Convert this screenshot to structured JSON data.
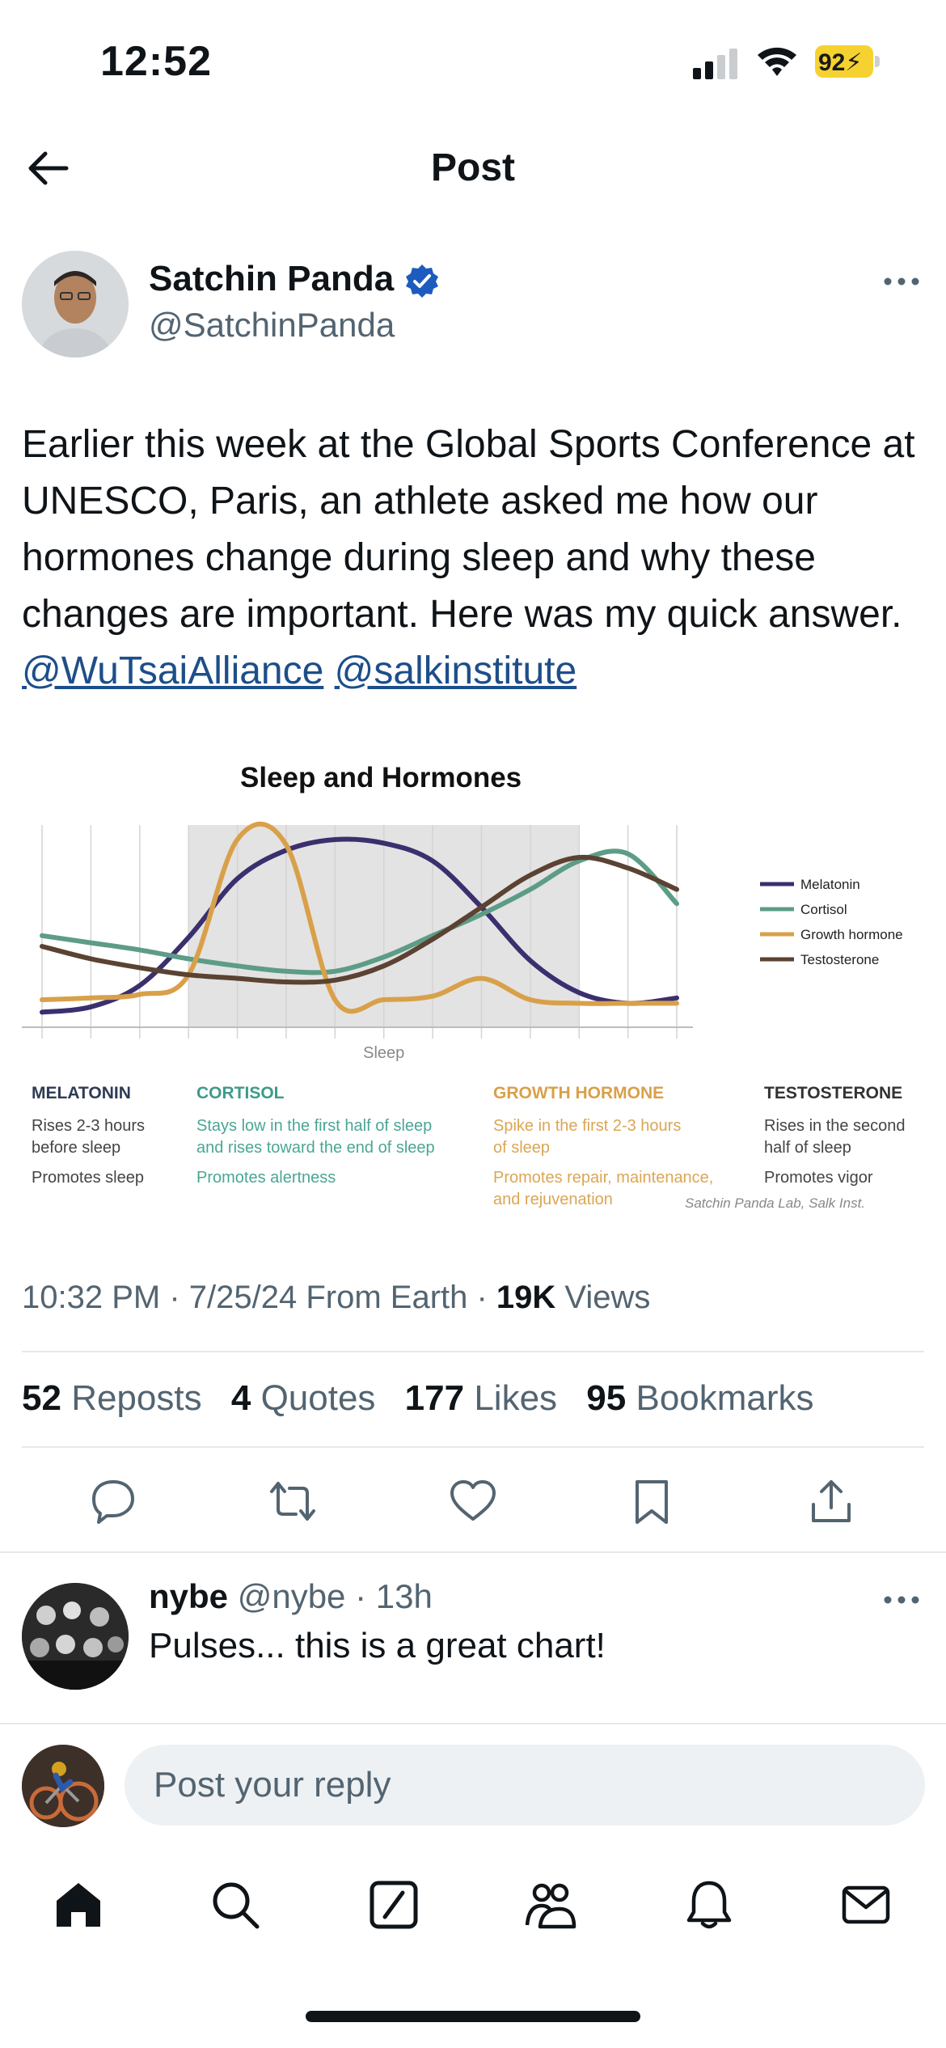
{
  "status_bar": {
    "time": "12:52",
    "battery": "92"
  },
  "header": {
    "title": "Post",
    "back_icon": "arrow-left-icon"
  },
  "post": {
    "author_name": "Satchin Panda",
    "author_handle": "@SatchinPanda",
    "text_plain": "Earlier this week at the Global Sports Conference at UNESCO, Paris, an athlete asked me how our hormones change during sleep and why these changes are important. Here was my quick answer. ",
    "mention_1": "@WuTsaiAlliance",
    "mention_2": "@salkinstitute",
    "timestamp": "10:32 PM · 7/25/24 From Earth · ",
    "views_count": "19K",
    "views_label": " Views",
    "stats": [
      {
        "count": "52",
        "label": "Reposts"
      },
      {
        "count": "4",
        "label": "Quotes"
      },
      {
        "count": "177",
        "label": "Likes"
      },
      {
        "count": "95",
        "label": "Bookmarks"
      }
    ]
  },
  "chart_data": {
    "type": "line",
    "title": "Sleep and Hormones",
    "xlabel": "Sleep",
    "x": [
      0,
      1,
      2,
      3,
      4,
      5,
      6,
      7,
      8,
      9,
      10,
      11,
      12,
      13
    ],
    "ylim": [
      0,
      1
    ],
    "sleep_period": [
      3,
      11
    ],
    "legend_position": "right",
    "series": [
      {
        "name": "Melatonin",
        "color": "#3b2f6e",
        "values": [
          0.03,
          0.06,
          0.18,
          0.45,
          0.78,
          0.94,
          1.0,
          0.98,
          0.88,
          0.62,
          0.32,
          0.14,
          0.08,
          0.11
        ]
      },
      {
        "name": "Cortisol",
        "color": "#5d9c86",
        "values": [
          0.46,
          0.42,
          0.38,
          0.33,
          0.29,
          0.26,
          0.26,
          0.34,
          0.46,
          0.58,
          0.72,
          0.88,
          0.92,
          0.64
        ]
      },
      {
        "name": "Growth hormone",
        "color": "#d9a04a",
        "values": [
          0.1,
          0.11,
          0.13,
          0.24,
          1.0,
          0.97,
          0.1,
          0.1,
          0.12,
          0.22,
          0.1,
          0.08,
          0.08,
          0.08
        ]
      },
      {
        "name": "Testosterone",
        "color": "#5b4232",
        "values": [
          0.4,
          0.33,
          0.28,
          0.24,
          0.22,
          0.2,
          0.21,
          0.29,
          0.44,
          0.62,
          0.8,
          0.9,
          0.84,
          0.72
        ]
      }
    ],
    "descriptions": [
      {
        "title": "MELATONIN",
        "color": "#2f3a55",
        "line1": "Rises 2-3 hours\nbefore sleep",
        "line2": "Promotes sleep"
      },
      {
        "title": "CORTISOL",
        "color": "#3f9a8a",
        "line1": "Stays low in the first half of sleep\nand rises toward the end of sleep",
        "line2": "Promotes alertness"
      },
      {
        "title": "GROWTH HORMONE",
        "color": "#d9a04a",
        "line1": "Spike in the first 2-3 hours\nof sleep",
        "line2": "Promotes repair, maintenance,\nand rejuvenation"
      },
      {
        "title": "TESTOSTERONE",
        "color": "#333333",
        "line1": "Rises in the second\nhalf of sleep",
        "line2": "Promotes vigor"
      }
    ],
    "credit": "Satchin Panda Lab, Salk Inst."
  },
  "reply": {
    "name": "nybe",
    "handle": "@nybe",
    "time": " · 13h",
    "text": "Pulses... this is a great chart!"
  },
  "composer": {
    "placeholder": "Post your reply"
  },
  "nav": [
    "home-icon",
    "search-icon",
    "grok-icon",
    "communities-icon",
    "notifications-icon",
    "messages-icon"
  ]
}
